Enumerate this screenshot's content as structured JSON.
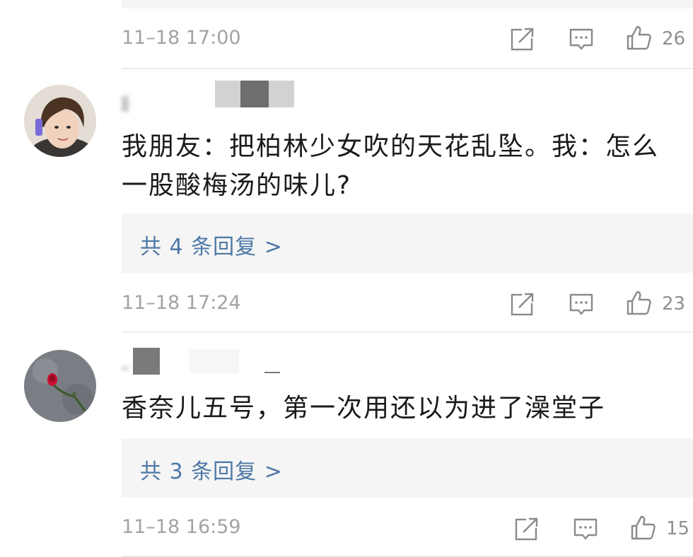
{
  "comments": [
    {
      "time": "11–18 17:00",
      "likes": "26"
    },
    {
      "text_line1": "我朋友：把柏林少女吹的天花乱坠。我：怎么",
      "text_line2": "一股酸梅汤的味儿?",
      "reply_label": "共 4 条回复 >",
      "time": "11–18 17:24",
      "likes": "23"
    },
    {
      "text_line1": "香奈儿五号，第一次用还以为进了澡堂子",
      "reply_label": "共 3 条回复 >",
      "time": "11–18 16:59",
      "likes": "15"
    }
  ],
  "icons": {
    "share": "share-icon",
    "comment": "comment-icon",
    "like": "thumbs-up-icon"
  },
  "colors": {
    "link": "#4d78a6",
    "meta": "#a3a3a3",
    "reply_bg": "#f5f5f5"
  }
}
